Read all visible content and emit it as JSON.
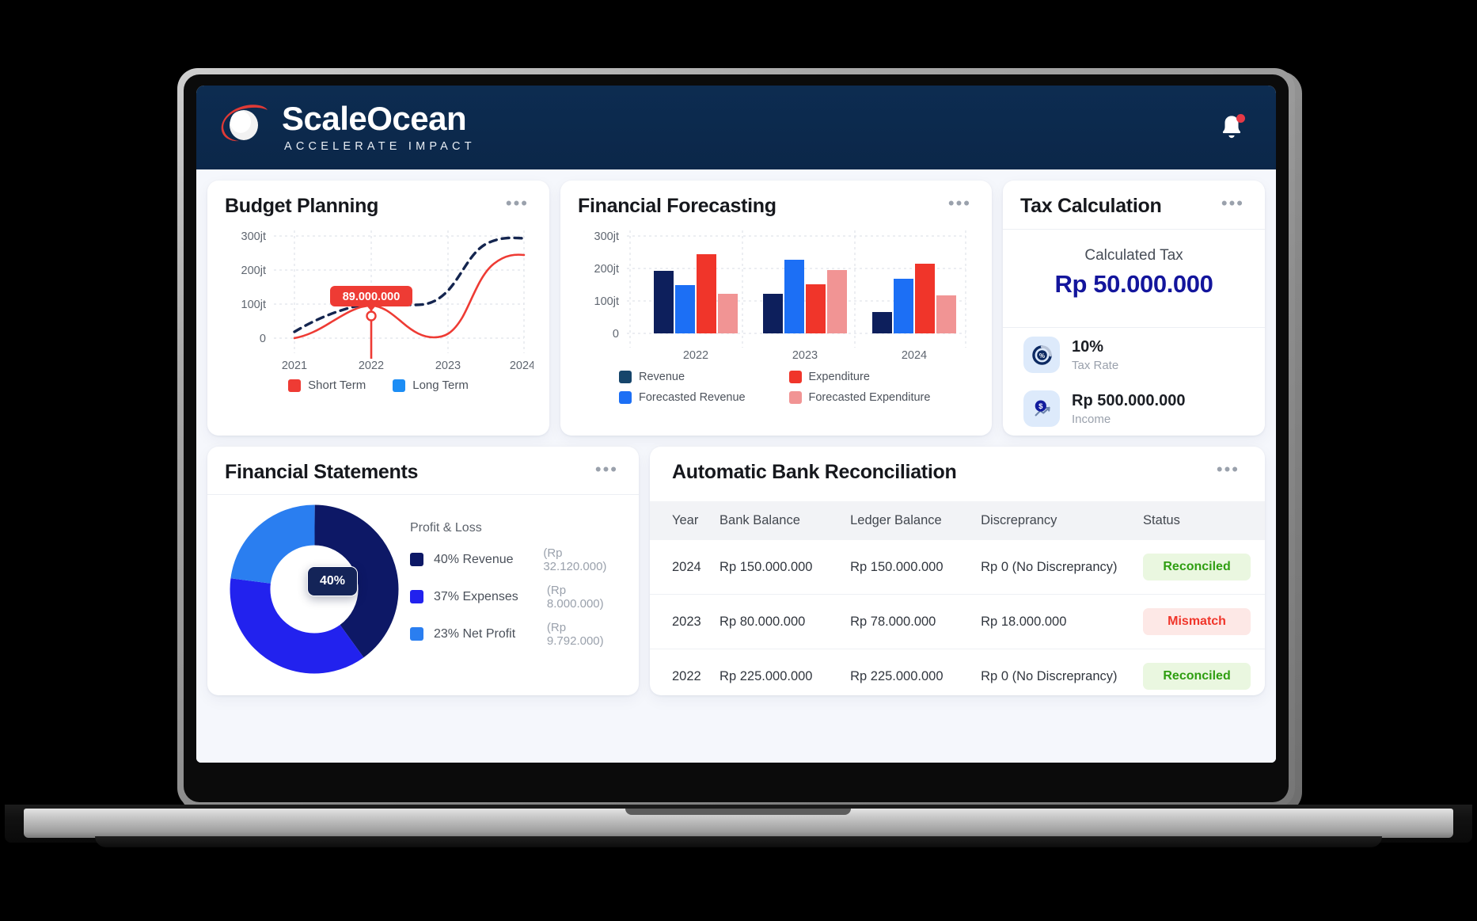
{
  "header": {
    "brand_name": "ScaleOcean",
    "brand_tagline": "ACCELERATE IMPACT",
    "logo_icon": "scaleocean-swoosh-logo",
    "notification_icon": "bell-icon"
  },
  "cards": {
    "budget": {
      "title": "Budget Planning",
      "menu": "•••"
    },
    "forecast": {
      "title": "Financial Forecasting",
      "menu": "•••"
    },
    "tax": {
      "title": "Tax Calculation",
      "menu": "•••"
    },
    "statements": {
      "title": "Financial Statements",
      "menu": "•••"
    },
    "reconciliation": {
      "title": "Automatic Bank Reconciliation",
      "menu": "•••"
    }
  },
  "tax": {
    "calculated_label": "Calculated Tax",
    "calculated_value": "Rp 50.000.000",
    "stats": [
      {
        "value": "10%",
        "label": "Tax Rate",
        "icon": "percent-circle-icon"
      },
      {
        "value": "Rp 500.000.000",
        "label": "Income",
        "icon": "dollar-trend-icon"
      }
    ]
  },
  "reconciliation": {
    "columns": [
      "Year",
      "Bank Balance",
      "Ledger Balance",
      "Discreprancy",
      "Status"
    ],
    "rows": [
      {
        "year": "2024",
        "bank": "Rp 150.000.000",
        "ledger": "Rp 150.000.000",
        "disc": "Rp 0 (No Discreprancy)",
        "status": "Reconciled",
        "state": "ok"
      },
      {
        "year": "2023",
        "bank": "Rp 80.000.000",
        "ledger": "Rp 78.000.000",
        "disc": "Rp 18.000.000",
        "status": "Mismatch",
        "state": "bad"
      },
      {
        "year": "2022",
        "bank": "Rp 225.000.000",
        "ledger": "Rp 225.000.000",
        "disc": "Rp 0 (No Discreprancy)",
        "status": "Reconciled",
        "state": "ok"
      }
    ]
  },
  "colors": {
    "brand_navy": "#0b2749",
    "brand_red": "#e03a36",
    "revenue": "#0d1f5c",
    "forecasted_revenue": "#1c6ff5",
    "expenditure": "#f0352a",
    "forecasted_expenditure": "#f19494",
    "short_term": "#ee3b34",
    "long_term": "#1c8df5",
    "donut_revenue": "#0d1866",
    "donut_expenses": "#2222ee",
    "donut_netprofit": "#2a7ef0",
    "tax_value": "#13159c",
    "status_ok": "#2f9e11",
    "status_bad": "#f0352a"
  },
  "chart_data": [
    {
      "type": "line",
      "title": "Budget Planning",
      "id": "budget-planning",
      "xlabel": "",
      "ylabel": "",
      "x": [
        "2021",
        "2022",
        "2023",
        "2024"
      ],
      "ytick_labels": [
        "0",
        "100jt",
        "200jt",
        "300jt"
      ],
      "ytick_values": [
        0,
        100,
        200,
        300
      ],
      "ylim": [
        0,
        330
      ],
      "grid": true,
      "legend_position": "bottom-center",
      "annotation": {
        "label": "89.000.000",
        "x": "2022",
        "y": 89,
        "marker": "hollow-circle"
      },
      "series": [
        {
          "name": "Short Term",
          "color": "#ee3b34",
          "style": "solid",
          "values": [
            18,
            89,
            22,
            250
          ]
        },
        {
          "name": "Long Term",
          "color": "#1c8df5",
          "legend_color": "#1c8df5",
          "line_color": "#14254f",
          "style": "dashed",
          "values": [
            22,
            108,
            105,
            298
          ]
        }
      ]
    },
    {
      "type": "bar",
      "title": "Financial Forecasting",
      "id": "financial-forecasting",
      "categories": [
        "2022",
        "2023",
        "2024"
      ],
      "ytick_labels": [
        "0",
        "100jt",
        "200jt",
        "300jt"
      ],
      "ytick_values": [
        0,
        100,
        200,
        300
      ],
      "ylim": [
        0,
        330
      ],
      "grid": true,
      "legend_position": "bottom",
      "series": [
        {
          "name": "Revenue",
          "color": "#0d1f5c",
          "values": [
            192,
            122,
            66
          ]
        },
        {
          "name": "Forecasted Revenue",
          "color": "#1c6ff5",
          "values": [
            150,
            227,
            168
          ]
        },
        {
          "name": "Expenditure",
          "color": "#f0352a",
          "values": [
            244,
            152,
            215
          ]
        },
        {
          "name": "Forecasted Expenditure",
          "color": "#f19494",
          "values": [
            123,
            195,
            118
          ]
        }
      ]
    },
    {
      "type": "pie",
      "title": "Financial Statements",
      "id": "financial-statements",
      "subtitle": "Profit & Loss",
      "center_badge": "40%",
      "slices": [
        {
          "label": "40% Revenue",
          "value": 40,
          "amount": "(Rp 32.120.000)",
          "color": "#0d1866"
        },
        {
          "label": "37% Expenses",
          "value": 37,
          "amount": "(Rp 8.000.000)",
          "color": "#2222ee"
        },
        {
          "label": "23% Net Profit",
          "value": 23,
          "amount": "(Rp 9.792.000)",
          "color": "#2a7ef0"
        }
      ]
    }
  ]
}
